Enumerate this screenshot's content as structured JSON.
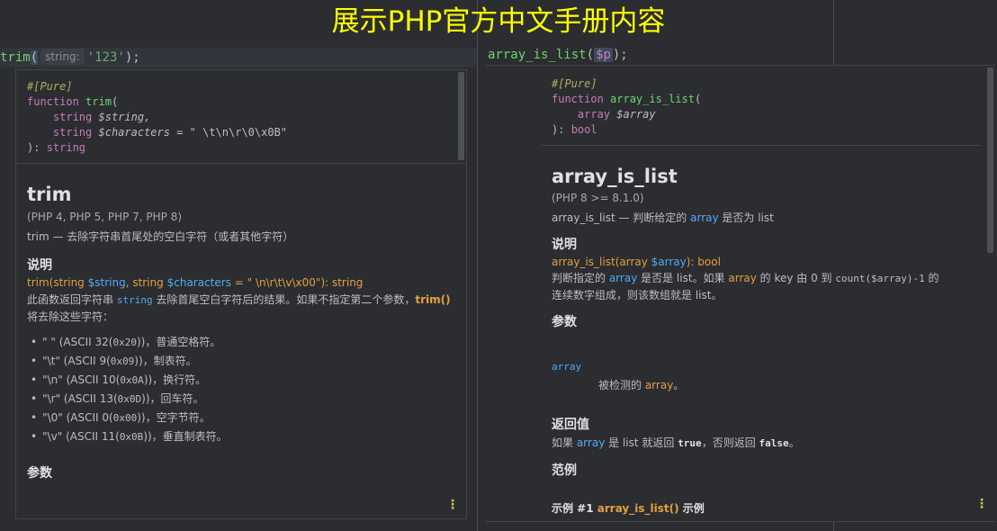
{
  "banner": {
    "title": "展示PHP官方中文手册内容"
  },
  "left": {
    "editor": {
      "fn": "trim",
      "open": "(",
      "hint": "string:",
      "arg": "'123'",
      "close": ");"
    },
    "signature": {
      "attribute": "#[Pure]",
      "kw_function": "function",
      "name": "trim",
      "open": "(",
      "p1_type": "string",
      "p1_var": "$string,",
      "p2_type": "string",
      "p2_var": "$characters",
      "p2_default": " = \" \\t\\n\\r\\0\\x0B\"",
      "close": "): ",
      "return_type": "string"
    },
    "doc": {
      "title": "trim",
      "versions": "(PHP 4, PHP 5, PHP 7, PHP 8)",
      "summary": "trim — 去除字符串首尾处的空白字符（或者其他字符）",
      "description_heading": "说明",
      "syn_name": "trim",
      "syn_open": "(string ",
      "syn_var1": "$string",
      "syn_mid": ", string ",
      "syn_var2": "$characters",
      "syn_rest": " = \" \\n\\r\\t\\v\\x00\"): string",
      "desc_1": "此函数返回字符串 ",
      "desc_kw": "string",
      "desc_2": " 去除首尾空白字符后的结果。如果不指定第二个参数，",
      "desc_fn": "trim()",
      "desc_3": " 将去除这些字符：",
      "chars": [
        {
          "pre": "\" \" (ASCII 32(",
          "code": "0x20",
          "post": "))，普通空格符。"
        },
        {
          "pre": "\"\\t\" (ASCII 9(",
          "code": "0x09",
          "post": "))，制表符。"
        },
        {
          "pre": "\"\\n\" (ASCII 10(",
          "code": "0x0A",
          "post": "))，换行符。"
        },
        {
          "pre": "\"\\r\" (ASCII 13(",
          "code": "0x0D",
          "post": "))，回车符。"
        },
        {
          "pre": "\"\\0\" (ASCII 0(",
          "code": "0x00",
          "post": "))，空字节符。"
        },
        {
          "pre": "\"\\v\" (ASCII 11(",
          "code": "0x0B",
          "post": "))，垂直制表符。"
        }
      ],
      "params_heading": "参数"
    }
  },
  "right": {
    "editor": {
      "fn": "array_is_list",
      "open": "(",
      "arg": "$p",
      "close": ");"
    },
    "signature": {
      "attribute": "#[Pure]",
      "kw_function": "function",
      "name": "array_is_list",
      "open": "(",
      "p1_type": "array",
      "p1_var": "$array",
      "close": "): ",
      "return_type": "bool"
    },
    "doc": {
      "title": "array_is_list",
      "versions": "(PHP 8 >= 8.1.0)",
      "summary_1": "array_is_list — 判断给定的 ",
      "summary_kw": "array",
      "summary_2": " 是否为 list",
      "description_heading": "说明",
      "syn_name": "array_is_list",
      "syn_open": "(array ",
      "syn_var": "$array",
      "syn_rest": "): bool",
      "desc_1": "判断指定的 ",
      "desc_kw1": "array",
      "desc_2": " 是否是 list。如果 ",
      "desc_kw2": "array",
      "desc_3": " 的 key 由 0 到 ",
      "desc_code": "count($array)-1",
      "desc_4": " 的",
      "desc_line2": "连续数字组成，则该数组就是 list。",
      "params_heading": "参数",
      "param_name": "array",
      "param_desc_1": "被检测的 ",
      "param_desc_kw": "array",
      "param_desc_2": "。",
      "return_heading": "返回值",
      "ret_1": "如果 ",
      "ret_kw": "array",
      "ret_2": " 是 list 就返回 ",
      "ret_true": "true",
      "ret_3": "，否则返回 ",
      "ret_false": "false",
      "ret_4": "。",
      "examples_heading": "范例",
      "example_1": "示例 #1 ",
      "example_fn": "array_is_list()",
      "example_2": " 示例"
    }
  },
  "menu_icon": "⋮",
  "colors": {
    "banner": "#ffff00",
    "accent_blue": "#56a8f5",
    "accent_orange": "#e3a040",
    "accent_green": "#6ed56e"
  }
}
